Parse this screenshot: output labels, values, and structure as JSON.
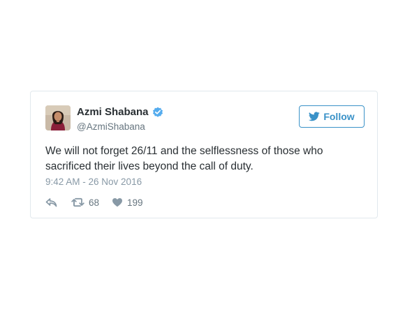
{
  "tweet": {
    "author": {
      "display_name": "Azmi Shabana",
      "screen_name": "@AzmiShabana",
      "verified": true,
      "avatar_icon": "profile-photo"
    },
    "follow_label": "Follow",
    "text": "We will not forget 26/11 and the selflessness of those who sacrificed their lives beyond the call of duty.",
    "timestamp": "9:42 AM - 26 Nov 2016",
    "actions": {
      "reply_icon": "reply-icon",
      "retweet_icon": "retweet-icon",
      "retweet_count": "68",
      "like_icon": "heart-icon",
      "like_count": "199"
    }
  },
  "colors": {
    "accent": "#3a92c8",
    "verified": "#55acee",
    "text": "#292f33",
    "muted": "#8899a6",
    "border": "#e1e8ed"
  }
}
